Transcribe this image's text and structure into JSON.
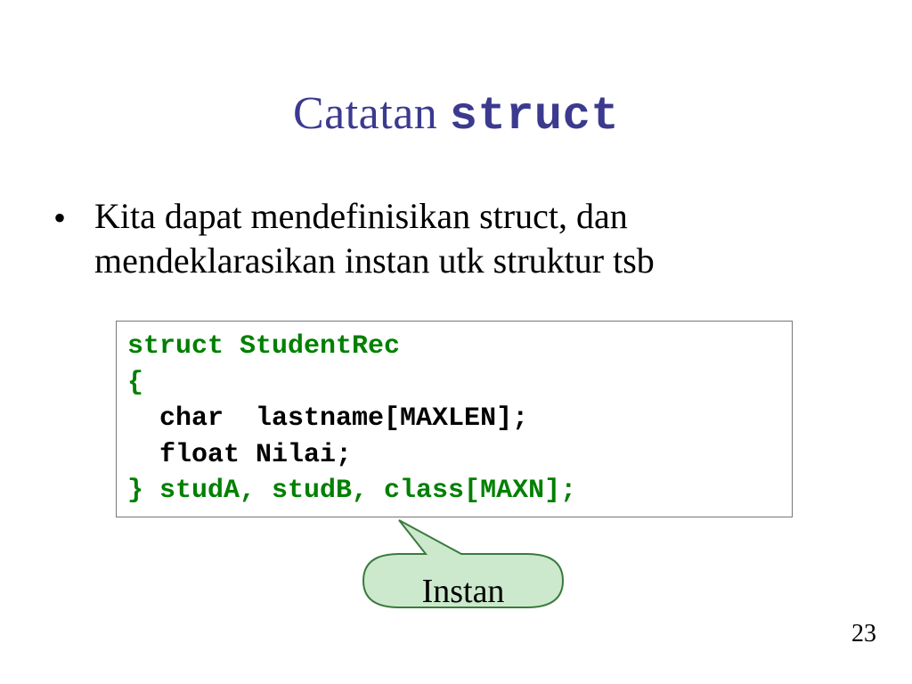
{
  "title": {
    "part1": "Catatan ",
    "part2": "struct"
  },
  "bullet": "Kita dapat mendefinisikan struct, dan mendeklarasikan instan utk struktur tsb",
  "code": {
    "l1": "struct StudentRec",
    "l2": "{",
    "l3a": "  char  lastname[MAXLEN];",
    "l4a": "  float Nilai;",
    "l5": "} studA, studB, class[MAXN];"
  },
  "callout": "Instan",
  "page": "23"
}
